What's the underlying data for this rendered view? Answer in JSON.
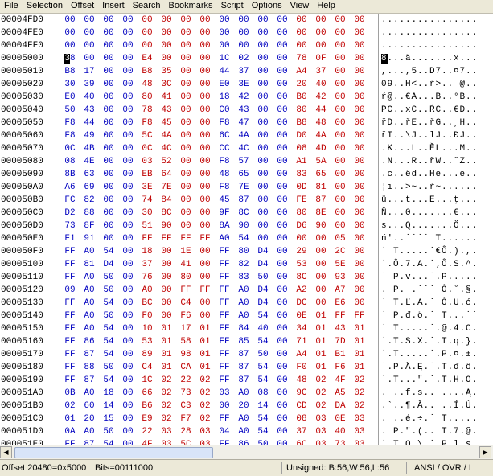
{
  "menu": [
    "File",
    "Selection",
    "Offset",
    "Insert",
    "Search",
    "Bookmarks",
    "Script",
    "Options",
    "View",
    "Help"
  ],
  "rows": [
    {
      "off": "00004FD0",
      "hex": "00 00 00 00 00 00 00 00 00 00 00 00 00 00 00 00",
      "asc": "................"
    },
    {
      "off": "00004FE0",
      "hex": "00 00 00 00 00 00 00 00 00 00 00 00 00 00 00 00",
      "asc": "................"
    },
    {
      "off": "00004FF0",
      "hex": "00 00 00 00 00 00 00 00 00 00 00 00 00 00 00 00",
      "asc": "................"
    },
    {
      "off": "00005000",
      "hex": "38 00 00 00 E4 00 00 00 1C 02 00 00 78 0F 00 00",
      "asc": "8...ä.......x..."
    },
    {
      "off": "00005010",
      "hex": "B8 17 00 00 B8 35 00 00 44 37 00 00 A4 37 00 00",
      "asc": ",...,5..D7..¤7.."
    },
    {
      "off": "00005020",
      "hex": "30 39 00 00 48 3C 00 00 E0 3E 00 00 20 40 00 00",
      "asc": "09..H<..ŕ>.. @.."
    },
    {
      "off": "00005030",
      "hex": "E0 40 00 00 80 41 00 00 18 42 00 00 B0 42 00 00",
      "asc": "ŕ@..€A...B..°B.."
    },
    {
      "off": "00005040",
      "hex": "50 43 00 00 78 43 00 00 C0 43 00 00 80 44 00 00",
      "asc": "PC..xC..ŔC..€D.."
    },
    {
      "off": "00005050",
      "hex": "F8 44 00 00 F8 45 00 00 F8 47 00 00 B8 48 00 00",
      "asc": "řD..řE..řG..¸H.."
    },
    {
      "off": "00005060",
      "hex": "F8 49 00 00 5C 4A 00 00 6C 4A 00 00 D0 4A 00 00",
      "asc": "řI..\\J..lJ..ĐJ.."
    },
    {
      "off": "00005070",
      "hex": "0C 4B 00 00 0C 4C 00 00 CC 4C 00 00 08 4D 00 00",
      "asc": ".K...L..ĚL...M.."
    },
    {
      "off": "00005080",
      "hex": "08 4E 00 00 03 52 00 00 F8 57 00 00 A1 5A 00 00",
      "asc": ".N...R..řW..ˇZ.."
    },
    {
      "off": "00005090",
      "hex": "8B 63 00 00 EB 64 00 00 48 65 00 00 83 65 00 00",
      "asc": ".c..ëd..He...e.."
    },
    {
      "off": "000050A0",
      "hex": "A6 69 00 00 3E 7E 00 00 F8 7E 00 00 0D 81 00 00",
      "asc": "¦i..>~..ř~......"
    },
    {
      "off": "000050B0",
      "hex": "FC 82 00 00 74 84 00 00 45 87 00 00 FE 87 00 00",
      "asc": "ü...t...E...ţ..."
    },
    {
      "off": "000050C0",
      "hex": "D2 88 00 00 30 8C 00 00 9F 8C 00 00 80 8E 00 00",
      "asc": "Ň...0.......€..."
    },
    {
      "off": "000050D0",
      "hex": "73 8F 00 00 51 90 00 00 8A 90 00 00 D6 90 00 00",
      "asc": "s...Q.......Ö..."
    },
    {
      "off": "000050E0",
      "hex": "F1 91 00 00 FF FF FF FF A0 54 00 00 00 00 05 00",
      "asc": "ń'..˙˙˙˙ T......"
    },
    {
      "off": "000050F0",
      "hex": "FF A0 54 00 18 00 1E 00 FF 80 D4 00 29 00 2C 00",
      "asc": "˙ T.....˙€Ô.).,."
    },
    {
      "off": "00005100",
      "hex": "FF 81 D4 00 37 00 41 00 FF 82 D4 00 53 00 5E 00",
      "asc": "˙.Ô.7.A.˙‚Ô.S.^."
    },
    {
      "off": "00005110",
      "hex": "FF A0 50 00 76 00 80 00 FF 83 50 00 8C 00 93 00",
      "asc": "˙ P.v...˙.P....."
    },
    {
      "off": "00005120",
      "hex": "09 A0 50 00 A0 00 FF FF FF A0 D4 00 A2 00 A7 00",
      "asc": ". P. .˙˙˙ Ô.˘.§."
    },
    {
      "off": "00005130",
      "hex": "FF A0 54 00 BC 00 C4 00 FF A0 D4 00 DC 00 E6 00",
      "asc": "˙ T.Ľ.Ä.˙ Ô.Ü.ć."
    },
    {
      "off": "00005140",
      "hex": "FF A0 50 00 F0 00 F6 00 FF A0 54 00 0E 01 FF FF",
      "asc": "˙ P.đ.ö.˙ T...˙˙"
    },
    {
      "off": "00005150",
      "hex": "FF A0 54 00 10 01 17 01 FF 84 40 00 34 01 43 01",
      "asc": "˙ T.....˙.@.4.C."
    },
    {
      "off": "00005160",
      "hex": "FF 86 54 00 53 01 58 01 FF 85 54 00 71 01 7D 01",
      "asc": "˙.T.S.X.˙.T.q.}."
    },
    {
      "off": "00005170",
      "hex": "FF 87 54 00 89 01 98 01 FF 87 50 00 A4 01 B1 01",
      "asc": "˙.T.....˙.P.¤.±."
    },
    {
      "off": "00005180",
      "hex": "FF 88 50 00 C4 01 CA 01 FF 87 54 00 F0 01 F6 01",
      "asc": "˙.P.Ä.Ę.˙.T.đ.ö."
    },
    {
      "off": "00005190",
      "hex": "FF 87 54 00 1C 02 22 02 FF 87 54 00 48 02 4F 02",
      "asc": "˙.T...\".˙.T.H.O."
    },
    {
      "off": "000051A0",
      "hex": "0B A0 18 00 66 02 73 02 03 A0 08 00 9C 02 A5 02",
      "asc": ". ..f.s.. ....Ą."
    },
    {
      "off": "000051B0",
      "hex": "02 60 14 00 B6 02 C3 02 00 20 14 00 CD 02 DA 02",
      "asc": ".`..¶.Ă.. ..Í.Ú."
    },
    {
      "off": "000051C0",
      "hex": "01 20 15 00 E9 02 F7 02 FF A0 54 00 08 03 0E 03",
      "asc": ". ..é.÷.˙ T....."
    },
    {
      "off": "000051D0",
      "hex": "0A A0 50 00 22 03 28 03 04 A0 54 00 37 03 40 03",
      "asc": ". P.\".(.. T.7.@."
    },
    {
      "off": "000051E0",
      "hex": "FF 87 54 00 4F 03 5C 03 FF 86 50 00 6C 03 73 03",
      "asc": "˙.T.O.\\.˙.P.l.s."
    }
  ],
  "status": {
    "offset": "Offset 20480=0x5000",
    "bits": "Bits=00111000",
    "unsigned": "Unsigned: B:56,W:56,L:56",
    "mode": "ANSI / OVR / L"
  }
}
